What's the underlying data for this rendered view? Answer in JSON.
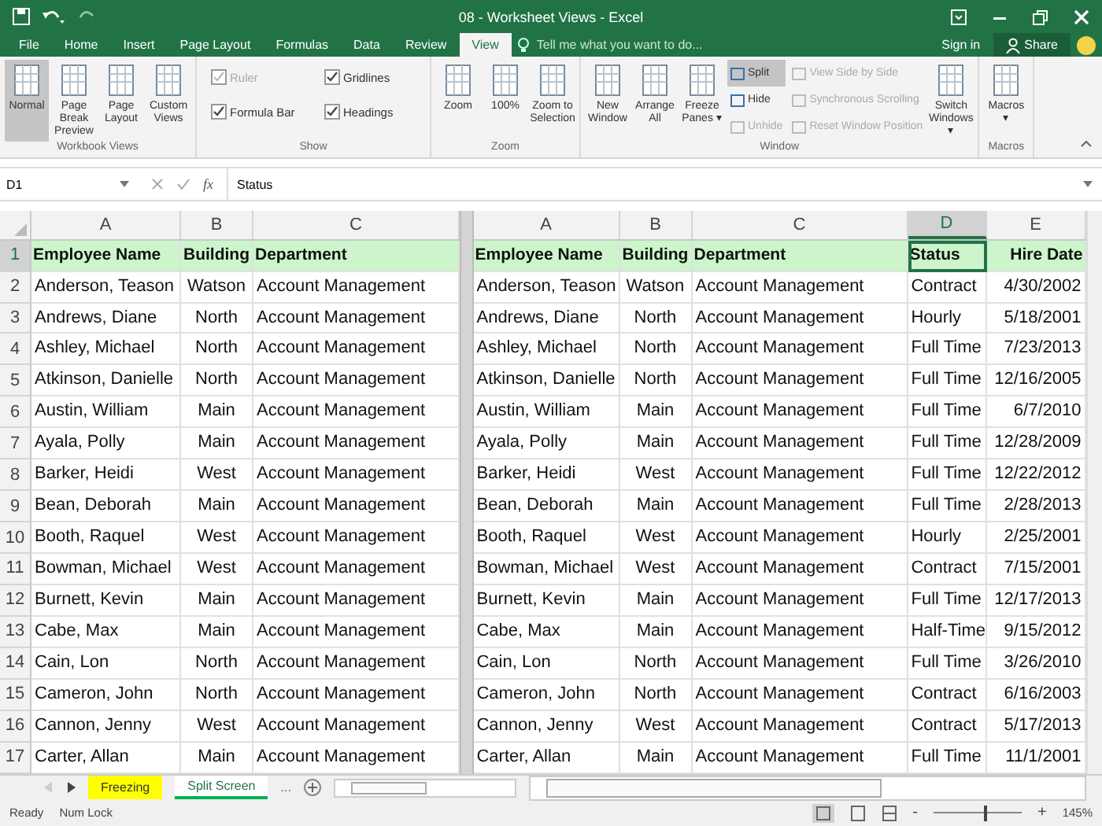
{
  "window": {
    "title": "08 - Worksheet Views - Excel"
  },
  "tabs": [
    {
      "label": "File",
      "selected": false
    },
    {
      "label": "Home",
      "selected": false
    },
    {
      "label": "Insert",
      "selected": false
    },
    {
      "label": "Page Layout",
      "selected": false
    },
    {
      "label": "Formulas",
      "selected": false
    },
    {
      "label": "Data",
      "selected": false
    },
    {
      "label": "Review",
      "selected": false
    },
    {
      "label": "View",
      "selected": true
    }
  ],
  "tell_me": {
    "placeholder": "Tell me what you want to do..."
  },
  "account": {
    "sign_in": "Sign in",
    "share": "Share"
  },
  "ribbon": {
    "groups": [
      {
        "label": "Workbook Views",
        "items": [
          {
            "kind": "big",
            "label": "Normal",
            "selected": true
          },
          {
            "kind": "big",
            "label": "Page Break Preview",
            "selected": false
          },
          {
            "kind": "big",
            "label": "Page Layout",
            "selected": false
          },
          {
            "kind": "big",
            "label": "Custom Views",
            "selected": false
          }
        ]
      },
      {
        "label": "Show",
        "items": [
          {
            "kind": "check",
            "label": "Ruler",
            "checked": true,
            "disabled": true
          },
          {
            "kind": "check",
            "label": "Formula Bar",
            "checked": true,
            "disabled": false
          },
          {
            "kind": "check",
            "label": "Gridlines",
            "checked": true,
            "disabled": false
          },
          {
            "kind": "check",
            "label": "Headings",
            "checked": true,
            "disabled": false
          }
        ]
      },
      {
        "label": "Zoom",
        "items": [
          {
            "kind": "big",
            "label": "Zoom",
            "selected": false
          },
          {
            "kind": "big",
            "label": "100%",
            "selected": false
          },
          {
            "kind": "big",
            "label": "Zoom to Selection",
            "selected": false
          }
        ]
      },
      {
        "label": "Window",
        "items": [
          {
            "kind": "big",
            "label": "New Window",
            "selected": false
          },
          {
            "kind": "big",
            "label": "Arrange All",
            "selected": false
          },
          {
            "kind": "big",
            "label": "Freeze Panes ▾",
            "selected": false
          },
          {
            "kind": "small",
            "label": "Split",
            "selected": true,
            "disabled": false
          },
          {
            "kind": "small",
            "label": "Hide",
            "selected": false,
            "disabled": false
          },
          {
            "kind": "small",
            "label": "Unhide",
            "selected": false,
            "disabled": true
          },
          {
            "kind": "small",
            "label": "View Side by Side",
            "selected": false,
            "disabled": true
          },
          {
            "kind": "small",
            "label": "Synchronous Scrolling",
            "selected": false,
            "disabled": true
          },
          {
            "kind": "small",
            "label": "Reset Window Position",
            "selected": false,
            "disabled": true
          },
          {
            "kind": "big",
            "label": "Switch Windows ▾",
            "selected": false
          }
        ]
      },
      {
        "label": "Macros",
        "items": [
          {
            "kind": "big",
            "label": "Macros ▾",
            "selected": false
          }
        ]
      }
    ]
  },
  "formula_bar": {
    "name_box": "D1",
    "function_label": "fx",
    "value": "Status"
  },
  "left_pane": {
    "columns": [
      {
        "label": "A",
        "selected": false
      },
      {
        "label": "B",
        "selected": false
      },
      {
        "label": "C",
        "selected": false
      }
    ],
    "rows": [
      {
        "number": "1",
        "selected": true,
        "header": true,
        "cells": [
          "Employee Name",
          "Building",
          "Department"
        ]
      },
      {
        "number": "2",
        "selected": false,
        "header": false,
        "cells": [
          "Anderson, Teason",
          "Watson",
          "Account Management"
        ]
      },
      {
        "number": "3",
        "selected": false,
        "header": false,
        "cells": [
          "Andrews, Diane",
          "North",
          "Account Management"
        ]
      },
      {
        "number": "4",
        "selected": false,
        "header": false,
        "cells": [
          "Ashley, Michael",
          "North",
          "Account Management"
        ]
      },
      {
        "number": "5",
        "selected": false,
        "header": false,
        "cells": [
          "Atkinson, Danielle",
          "North",
          "Account Management"
        ]
      },
      {
        "number": "6",
        "selected": false,
        "header": false,
        "cells": [
          "Austin, William",
          "Main",
          "Account Management"
        ]
      },
      {
        "number": "7",
        "selected": false,
        "header": false,
        "cells": [
          "Ayala, Polly",
          "Main",
          "Account Management"
        ]
      },
      {
        "number": "8",
        "selected": false,
        "header": false,
        "cells": [
          "Barker, Heidi",
          "West",
          "Account Management"
        ]
      },
      {
        "number": "9",
        "selected": false,
        "header": false,
        "cells": [
          "Bean, Deborah",
          "Main",
          "Account Management"
        ]
      },
      {
        "number": "10",
        "selected": false,
        "header": false,
        "cells": [
          "Booth, Raquel",
          "West",
          "Account Management"
        ]
      },
      {
        "number": "11",
        "selected": false,
        "header": false,
        "cells": [
          "Bowman, Michael",
          "West",
          "Account Management"
        ]
      },
      {
        "number": "12",
        "selected": false,
        "header": false,
        "cells": [
          "Burnett, Kevin",
          "Main",
          "Account Management"
        ]
      },
      {
        "number": "13",
        "selected": false,
        "header": false,
        "cells": [
          "Cabe, Max",
          "Main",
          "Account Management"
        ]
      },
      {
        "number": "14",
        "selected": false,
        "header": false,
        "cells": [
          "Cain, Lon",
          "North",
          "Account Management"
        ]
      },
      {
        "number": "15",
        "selected": false,
        "header": false,
        "cells": [
          "Cameron, John",
          "North",
          "Account Management"
        ]
      },
      {
        "number": "16",
        "selected": false,
        "header": false,
        "cells": [
          "Cannon, Jenny",
          "West",
          "Account Management"
        ]
      },
      {
        "number": "17",
        "selected": false,
        "header": false,
        "cells": [
          "Carter, Allan",
          "Main",
          "Account Management"
        ]
      }
    ]
  },
  "right_pane": {
    "columns": [
      {
        "label": "A",
        "selected": false
      },
      {
        "label": "B",
        "selected": false
      },
      {
        "label": "C",
        "selected": false
      },
      {
        "label": "D",
        "selected": true
      },
      {
        "label": "E",
        "selected": false
      }
    ],
    "rows": [
      {
        "selected": true,
        "header": true,
        "cells": [
          "Employee Name",
          "Building",
          "Department",
          "Status",
          "Hire Date"
        ]
      },
      {
        "selected": false,
        "header": false,
        "cells": [
          "Anderson, Teason",
          "Watson",
          "Account Management",
          "Contract",
          "4/30/2002"
        ]
      },
      {
        "selected": false,
        "header": false,
        "cells": [
          "Andrews, Diane",
          "North",
          "Account Management",
          "Hourly",
          "5/18/2001"
        ]
      },
      {
        "selected": false,
        "header": false,
        "cells": [
          "Ashley, Michael",
          "North",
          "Account Management",
          "Full Time",
          "7/23/2013"
        ]
      },
      {
        "selected": false,
        "header": false,
        "cells": [
          "Atkinson, Danielle",
          "North",
          "Account Management",
          "Full Time",
          "12/16/2005"
        ]
      },
      {
        "selected": false,
        "header": false,
        "cells": [
          "Austin, William",
          "Main",
          "Account Management",
          "Full Time",
          "6/7/2010"
        ]
      },
      {
        "selected": false,
        "header": false,
        "cells": [
          "Ayala, Polly",
          "Main",
          "Account Management",
          "Full Time",
          "12/28/2009"
        ]
      },
      {
        "selected": false,
        "header": false,
        "cells": [
          "Barker, Heidi",
          "West",
          "Account Management",
          "Full Time",
          "12/22/2012"
        ]
      },
      {
        "selected": false,
        "header": false,
        "cells": [
          "Bean, Deborah",
          "Main",
          "Account Management",
          "Full Time",
          "2/28/2013"
        ]
      },
      {
        "selected": false,
        "header": false,
        "cells": [
          "Booth, Raquel",
          "West",
          "Account Management",
          "Hourly",
          "2/25/2001"
        ]
      },
      {
        "selected": false,
        "header": false,
        "cells": [
          "Bowman, Michael",
          "West",
          "Account Management",
          "Contract",
          "7/15/2001"
        ]
      },
      {
        "selected": false,
        "header": false,
        "cells": [
          "Burnett, Kevin",
          "Main",
          "Account Management",
          "Full Time",
          "12/17/2013"
        ]
      },
      {
        "selected": false,
        "header": false,
        "cells": [
          "Cabe, Max",
          "Main",
          "Account Management",
          "Half-Time",
          "9/15/2012"
        ]
      },
      {
        "selected": false,
        "header": false,
        "cells": [
          "Cain, Lon",
          "North",
          "Account Management",
          "Full Time",
          "3/26/2010"
        ]
      },
      {
        "selected": false,
        "header": false,
        "cells": [
          "Cameron, John",
          "North",
          "Account Management",
          "Contract",
          "6/16/2003"
        ]
      },
      {
        "selected": false,
        "header": false,
        "cells": [
          "Cannon, Jenny",
          "West",
          "Account Management",
          "Contract",
          "5/17/2013"
        ]
      },
      {
        "selected": false,
        "header": false,
        "cells": [
          "Carter, Allan",
          "Main",
          "Account Management",
          "Full Time",
          "11/1/2001"
        ]
      }
    ]
  },
  "sheet_tabs": [
    {
      "label": "Freezing",
      "selected": false,
      "color": "#ffff00"
    },
    {
      "label": "Split Screen",
      "selected": true,
      "color": "#00b050"
    }
  ],
  "sheet_tabs_more": "...",
  "status_bar": {
    "items": [
      "Ready",
      "Num Lock"
    ],
    "zoom": "145%",
    "zoom_out": "-",
    "zoom_in": "+",
    "zoom_level": {
      "level": 0.57
    }
  }
}
